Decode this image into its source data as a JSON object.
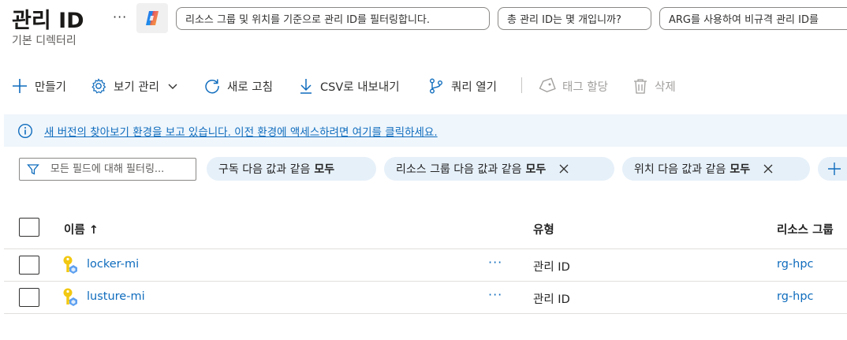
{
  "header": {
    "title": "관리 ID",
    "subtitle": "기본 디렉터리",
    "more_label": "···",
    "suggestions": [
      "리소스 그룹 및 위치를 기준으로 관리 ID를 필터링합니다.",
      "총 관리 ID는 몇 개입니까?",
      "ARG를 사용하여 비규격 관리 ID를"
    ]
  },
  "toolbar": {
    "create": "만들기",
    "manage_view": "보기 관리",
    "refresh": "새로 고침",
    "export_csv": "CSV로 내보내기",
    "open_query": "쿼리 열기",
    "assign_tags": "태그 할당",
    "delete": "삭제"
  },
  "banner": {
    "text": "새 버전의 찾아보기 환경을 보고 있습니다. 이전 환경에 액세스하려면 여기를 클릭하세요."
  },
  "filters": {
    "search_placeholder": "모든 필드에 대해 필터링...",
    "pills": [
      {
        "label": "구독 다음 값과 같음",
        "value": "모두"
      },
      {
        "label": "리소스 그룹 다음 값과 같음",
        "value": "모두"
      },
      {
        "label": "위치 다음 값과 같음",
        "value": "모두"
      }
    ]
  },
  "table": {
    "columns": {
      "name": "이름 ↑",
      "type": "유형",
      "resource_group": "리소스 그룹"
    },
    "row_menu": "···",
    "rows": [
      {
        "name": "locker-mi",
        "type": "관리 ID",
        "resource_group": "rg-hpc"
      },
      {
        "name": "lusture-mi",
        "type": "관리 ID",
        "resource_group": "rg-hpc"
      }
    ]
  },
  "colors": {
    "accent": "#0f6cbd",
    "banner_bg": "#eff6fc",
    "pill_bg": "#e6f0f9",
    "disabled": "#a19f9d"
  }
}
